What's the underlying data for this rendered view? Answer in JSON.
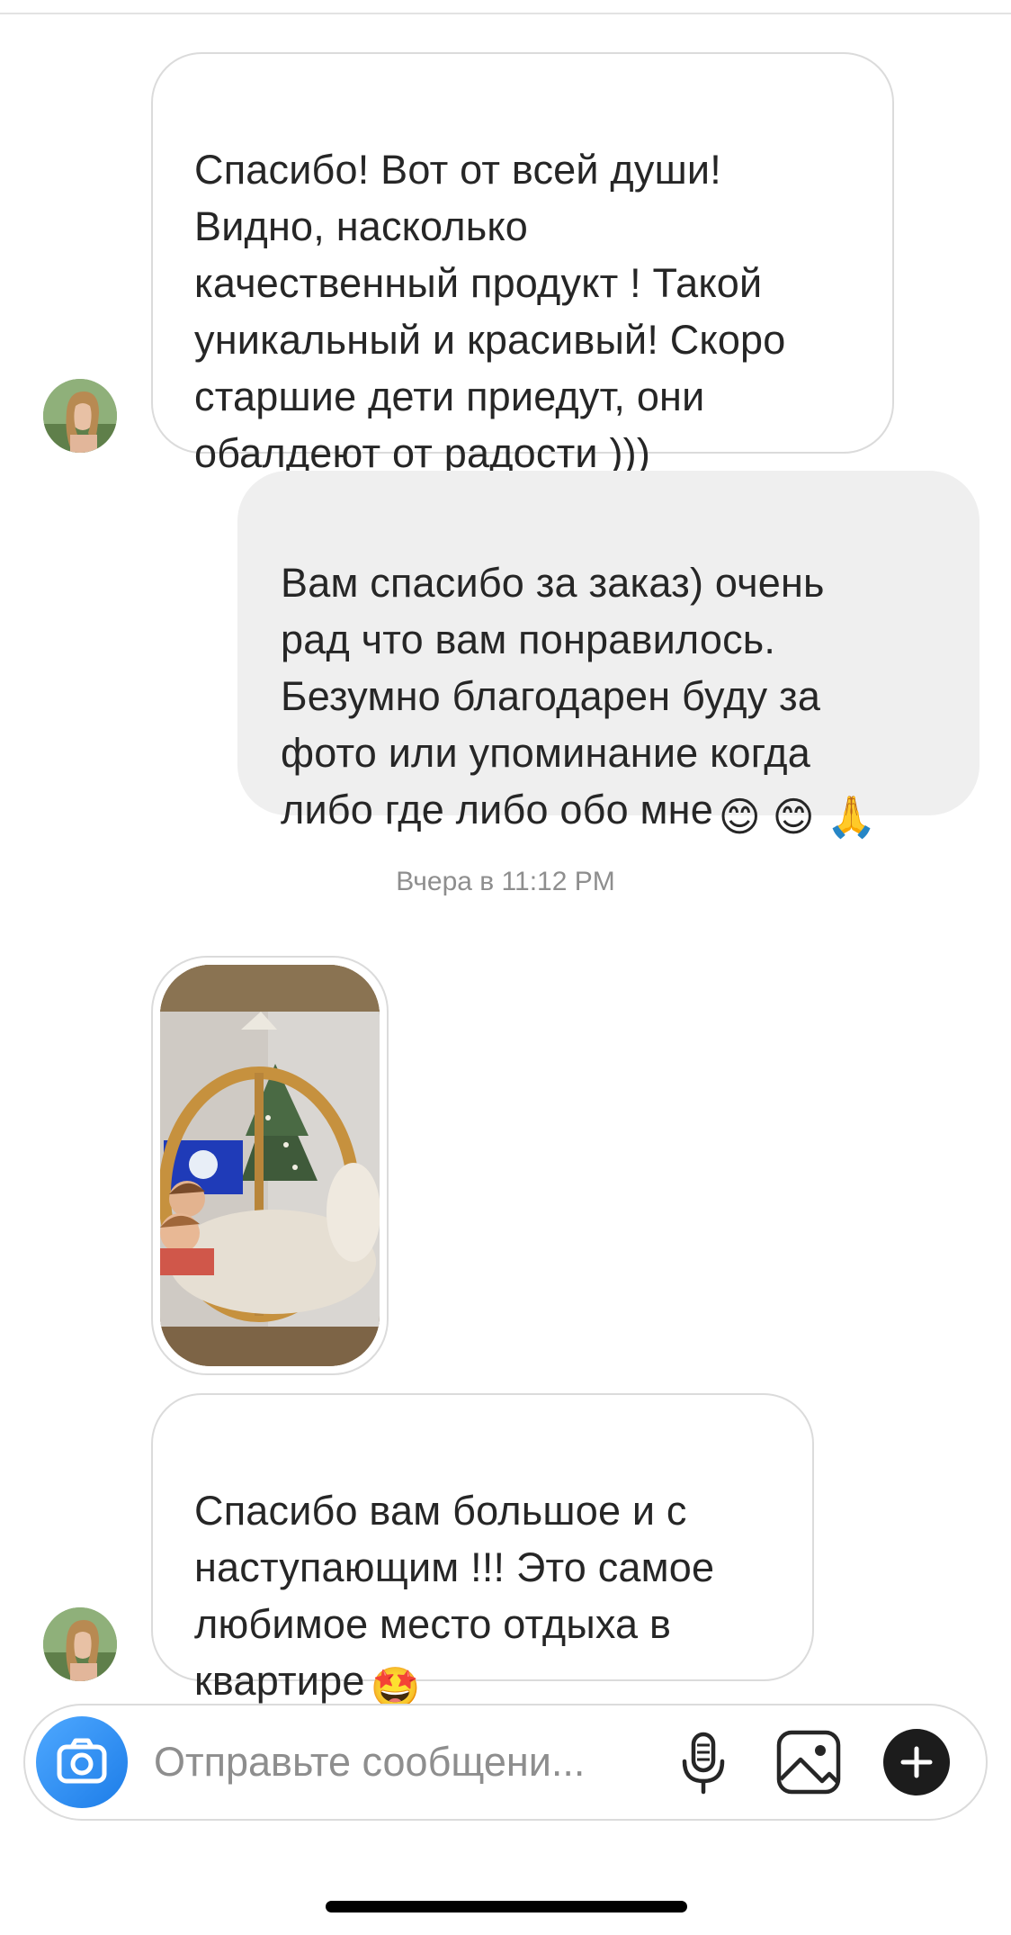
{
  "messages": {
    "msg1": {
      "sender": "contact",
      "text": "Спасибо! Вот от всей души!\nВидно, насколько\nкачественный продукт ! Такой\nуникальный и красивый! Скоро\nстаршие дети приедут, они\nобалдеют от радости )))"
    },
    "msg2": {
      "sender": "me",
      "text": "Вам спасибо за заказ) очень\nрад что вам понравилось.\nБезумно благодарен буду за\nфото или упоминание когда\nлибо где либо обо мне",
      "emojis": "😊 😊 🙏"
    },
    "timestamp": "Вчера в 11:12 PM",
    "msg3": {
      "sender": "contact",
      "type": "photo"
    },
    "msg4": {
      "sender": "contact",
      "text": "Спасибо  вам большое и с\nнаступающим !!! Это самое\nлюбимое место отдыха в\nквартире",
      "emojis": "🤩"
    }
  },
  "composer": {
    "placeholder": "Отправьте сообщени...",
    "camera_icon": "camera-icon",
    "mic_icon": "microphone-icon",
    "gallery_icon": "gallery-icon",
    "plus_icon": "plus-icon"
  },
  "colors": {
    "outgoing_bubble": "#efefef",
    "incoming_border": "#dbdbdb",
    "camera_button": "#2d8cf0",
    "timestamp_text": "#8e8e8e"
  }
}
